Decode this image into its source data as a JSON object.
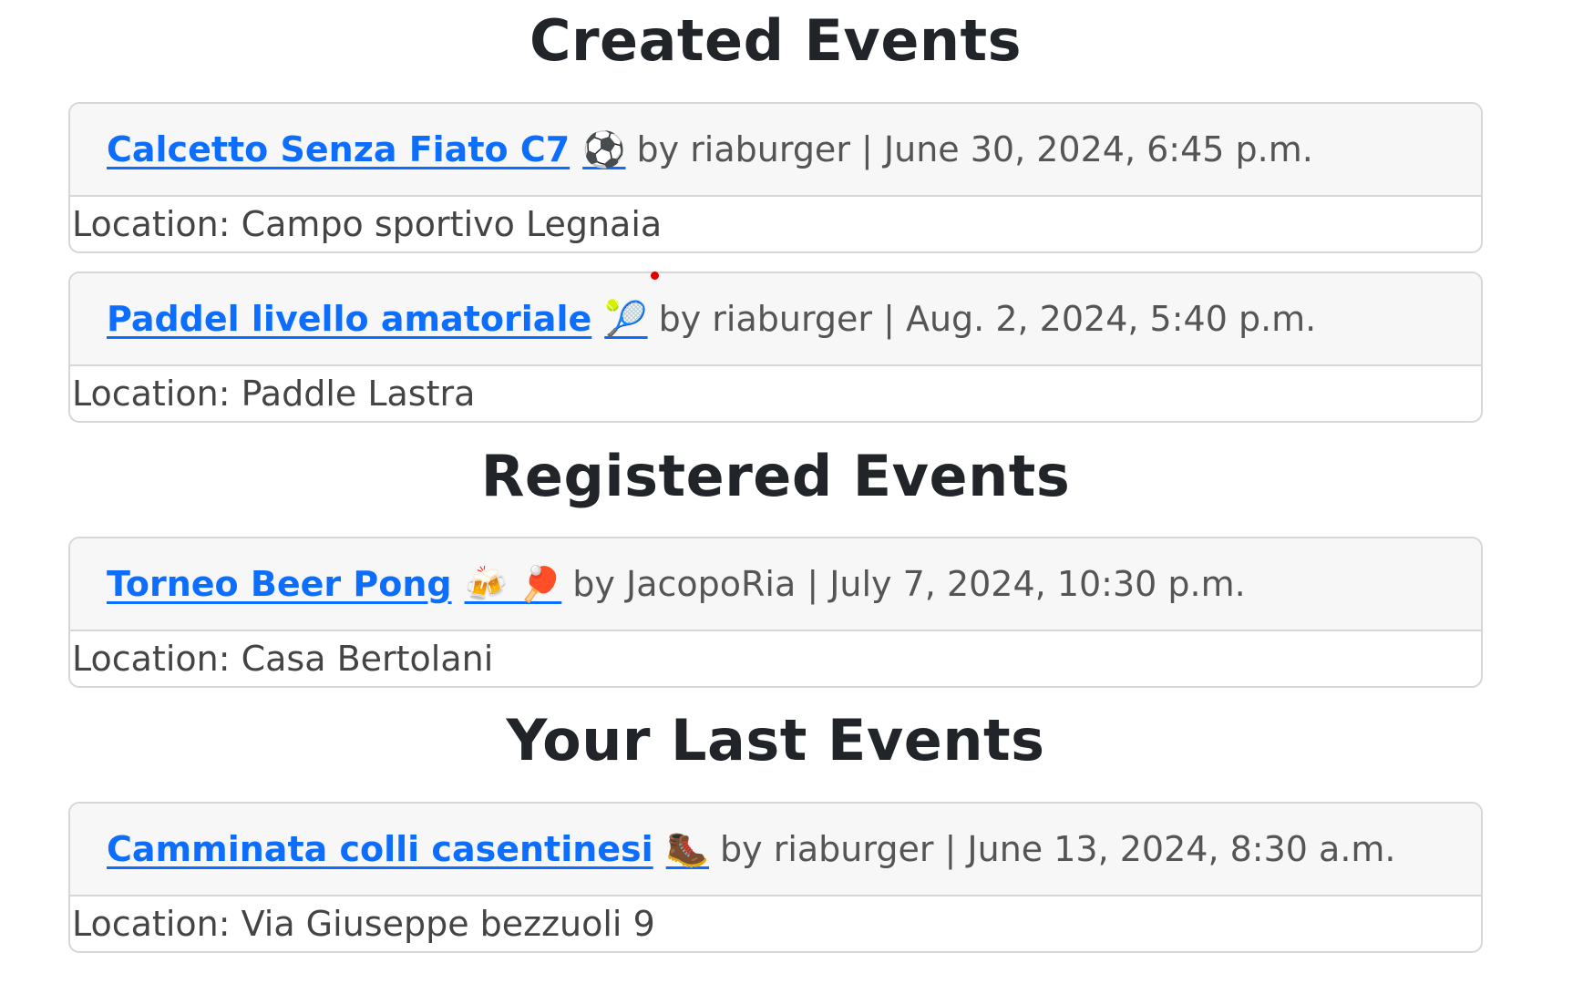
{
  "sections": [
    {
      "title": "Created Events",
      "events": [
        {
          "name": "Calcetto Senza Fiato C7",
          "emoji": "⚽",
          "meta": "by riaburger | June 30, 2024, 6:45 p.m.",
          "location": "Location: Campo sportivo Legnaia"
        },
        {
          "name": "Paddel livello amatoriale",
          "emoji": "🎾",
          "meta": "by riaburger | Aug. 2, 2024, 5:40 p.m.",
          "location": "Location: Paddle Lastra"
        }
      ]
    },
    {
      "title": "Registered Events",
      "events": [
        {
          "name": "Torneo Beer Pong",
          "emoji": "🍻 🏓",
          "meta": "by JacopoRia | July 7, 2024, 10:30 p.m.",
          "location": "Location: Casa Bertolani"
        }
      ]
    },
    {
      "title": "Your Last Events",
      "events": [
        {
          "name": "Camminata colli casentinesi",
          "emoji": "🥾",
          "meta": "by riaburger | June 13, 2024, 8:30 a.m.",
          "location": "Location: Via Giuseppe bezzuoli 9"
        }
      ]
    }
  ],
  "colors": {
    "link": "#0d6efd",
    "card_header_bg": "#f7f7f7",
    "card_border": "#d6d6d6",
    "heading": "#212529"
  }
}
